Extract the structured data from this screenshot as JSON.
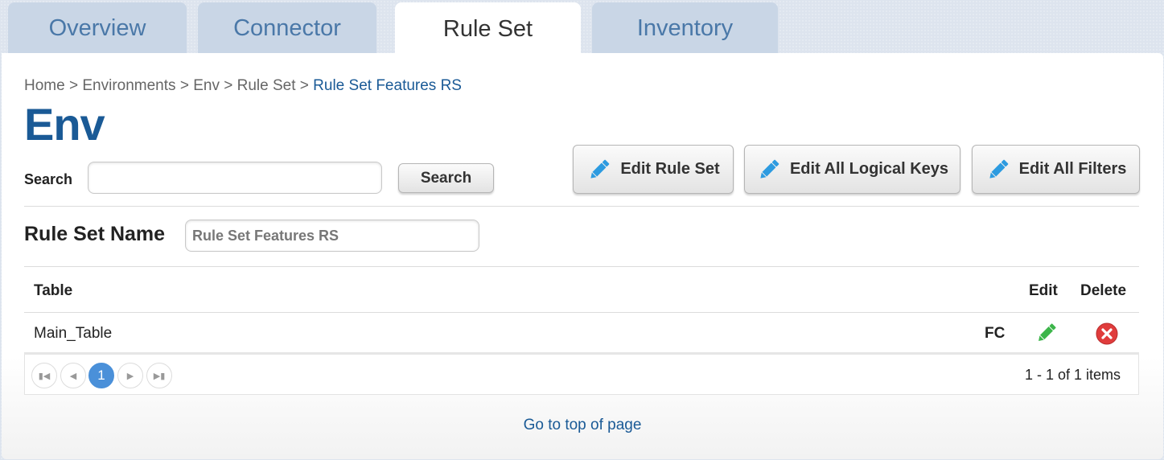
{
  "tabs": [
    {
      "label": "Overview"
    },
    {
      "label": "Connector"
    },
    {
      "label": "Rule Set"
    },
    {
      "label": "Inventory"
    }
  ],
  "breadcrumb": {
    "items": [
      "Home",
      "Environments",
      "Env",
      "Rule Set"
    ],
    "separator": ">",
    "current": "Rule Set Features RS"
  },
  "page_title": "Env",
  "search": {
    "label": "Search",
    "value": "",
    "button": "Search"
  },
  "actions": [
    {
      "label": "Edit Rule Set",
      "icon": "pencil-icon"
    },
    {
      "label": "Edit All Logical Keys",
      "icon": "pencil-icon"
    },
    {
      "label": "Edit All Filters",
      "icon": "pencil-icon"
    }
  ],
  "rule_set_name": {
    "label": "Rule Set Name",
    "value": "Rule Set Features RS"
  },
  "table": {
    "headers": {
      "table": "Table",
      "edit": "Edit",
      "delete": "Delete"
    },
    "rows": [
      {
        "table": "Main_Table",
        "flag": "FC",
        "edit_icon": "pencil-icon",
        "delete_icon": "delete-icon"
      }
    ]
  },
  "pager": {
    "current_page": "1",
    "info": "1 - 1 of 1 items"
  },
  "footer_link": "Go to top of page",
  "colors": {
    "brand_blue": "#1a5a96",
    "tab_inactive": "#c9d6e6",
    "pencil_blue": "#2d9be0",
    "pencil_green": "#3cb54a",
    "delete_red": "#e03c3c",
    "pager_active": "#4a90d9"
  }
}
